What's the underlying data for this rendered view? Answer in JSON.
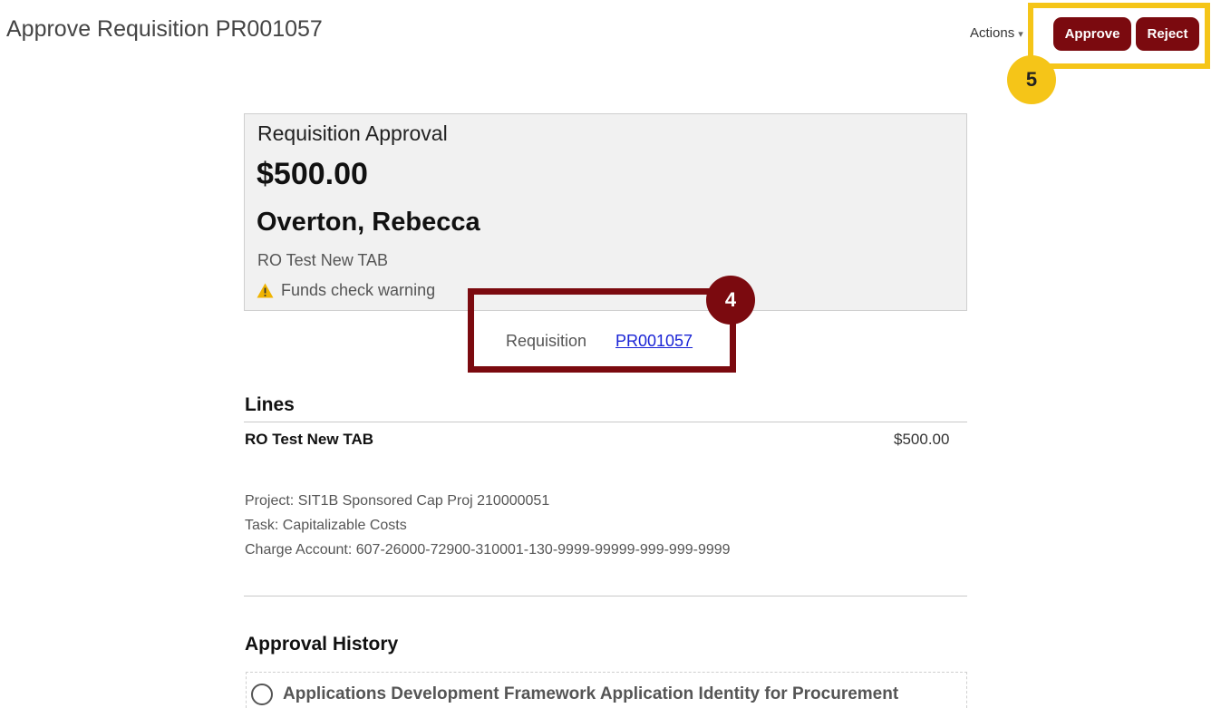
{
  "header": {
    "title": "Approve Requisition PR001057",
    "actions_label": "Actions",
    "approve_label": "Approve",
    "reject_label": "Reject"
  },
  "callouts": {
    "step4": "4",
    "step5": "5",
    "step4_color": "#7b0a0f",
    "step5_color": "#f5c518"
  },
  "summary": {
    "heading": "Requisition Approval",
    "amount": "$500.00",
    "requester": "Overton, Rebecca",
    "description": "RO Test New TAB",
    "warning": "Funds check warning"
  },
  "requisition": {
    "label": "Requisition",
    "number": "PR001057"
  },
  "lines": {
    "title": "Lines",
    "items": [
      {
        "name": "RO Test New TAB",
        "amount": "$500.00",
        "project": "Project: SIT1B Sponsored Cap Proj 210000051",
        "task": "Task: Capitalizable Costs",
        "charge_account": "Charge Account: 607-26000-72900-310001-130-9999-99999-999-999-9999"
      }
    ]
  },
  "approval_history": {
    "title": "Approval History",
    "entries": [
      {
        "name": "Applications Development Framework Application Identity for Procurement"
      }
    ]
  },
  "colors": {
    "brand_button": "#7b0a0f",
    "link": "#1a24d6",
    "warning_icon": "#f0b400",
    "card_background": "#f1f1f1"
  }
}
